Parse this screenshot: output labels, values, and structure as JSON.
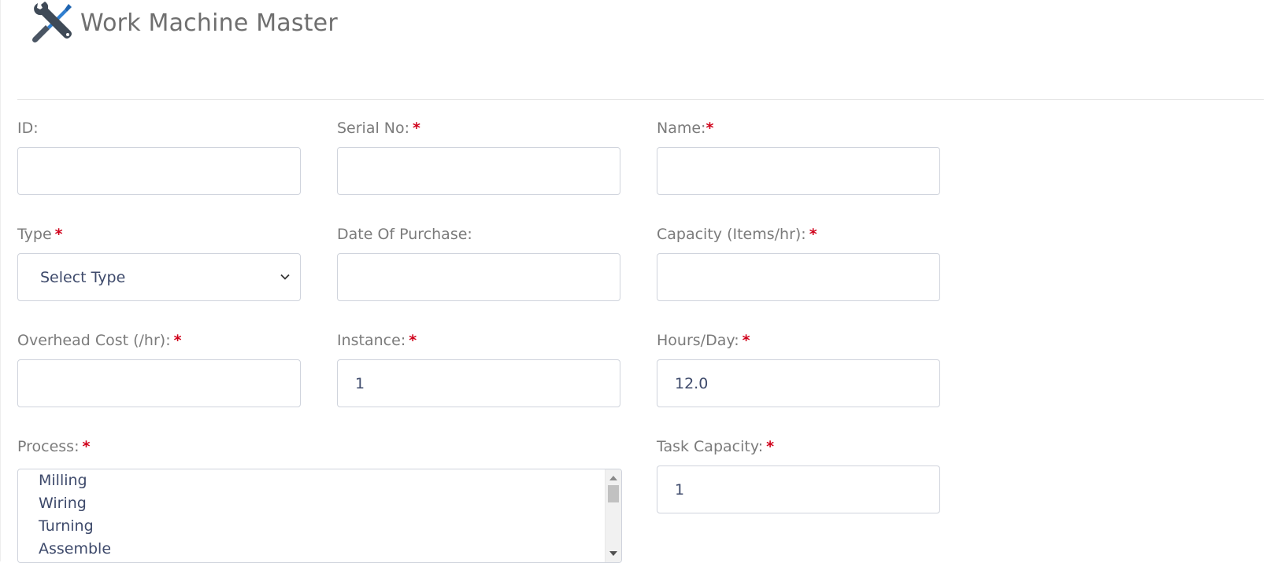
{
  "header": {
    "title": "Work Machine Master",
    "icon": "tools-icon"
  },
  "fields": {
    "id": {
      "label": "ID:",
      "value": ""
    },
    "serial_no": {
      "label": "Serial No:",
      "required": "*",
      "value": ""
    },
    "name": {
      "label": "Name:",
      "required": "*",
      "value": ""
    },
    "type": {
      "label": "Type",
      "required": "*",
      "selected": "Select Type"
    },
    "date_of_purchase": {
      "label": "Date Of Purchase:",
      "value": ""
    },
    "capacity": {
      "label": "Capacity (Items/hr):",
      "required": "*",
      "value": ""
    },
    "overhead_cost": {
      "label": "Overhead Cost (/hr):",
      "required": "*",
      "value": ""
    },
    "instance": {
      "label": "Instance:",
      "required": "*",
      "value": "1"
    },
    "hours_day": {
      "label": "Hours/Day:",
      "required": "*",
      "value": "12.0"
    },
    "process": {
      "label": "Process:",
      "required": "*",
      "options": [
        "Milling",
        "Wiring",
        "Turning",
        "Assemble"
      ]
    },
    "task_capacity": {
      "label": "Task Capacity:",
      "required": "*",
      "value": "1"
    }
  },
  "colors": {
    "required": "#d0021b",
    "input_text": "#3e4a6b",
    "label": "#7b7b7b",
    "border": "#cfd3dc"
  }
}
